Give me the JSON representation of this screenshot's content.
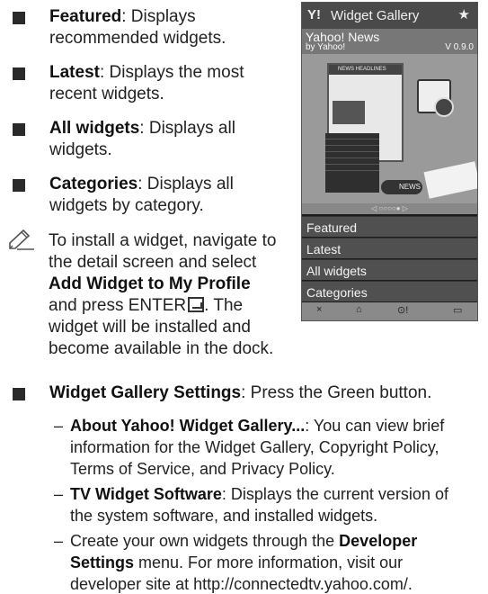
{
  "items": [
    {
      "label": "Featured",
      "desc_1": ": Displays",
      "desc_2": "recommended widgets."
    },
    {
      "label": "Latest",
      "desc_1": ": Displays the most",
      "desc_2": "recent widgets."
    },
    {
      "label": "All widgets",
      "desc_1": ": Displays all",
      "desc_2": "widgets."
    },
    {
      "label": "Categories",
      "desc_1": ": Displays all",
      "desc_2": "widgets by category."
    }
  ],
  "note": {
    "line1": "To install a widget, navigate to",
    "line2": "the detail screen and select",
    "line3_bold": "Add Widget to My Profile",
    "line4_pre": "and press ",
    "line4_enter": "ENTER",
    "line4_post": ". The",
    "line5": "widget will be installed and",
    "line6": "become available in the dock."
  },
  "widget_gallery_settings": {
    "label": "Widget Gallery Settings",
    "desc": ": Press the Green button.",
    "subs": [
      {
        "dash": "–",
        "label": "About Yahoo! Widget Gallery...",
        "text_1": ": You can view brief",
        "text_2": "information for the Widget Gallery, Copyright Policy,",
        "text_3": "Terms of Service, and Privacy Policy."
      },
      {
        "dash": "–",
        "label": "TV Widget Software",
        "text_1": ": Displays the current version of",
        "text_2": "the system software, and installed widgets."
      },
      {
        "dash": "–",
        "pre": "Create your own widgets through the ",
        "label_a": "Developer",
        "label_b": "Settings",
        "text_1": " menu. For more information, visit our",
        "text_2": "developer site at http://connectedtv.yahoo.com/."
      }
    ]
  },
  "tv_screen": {
    "header_logo": "Y!",
    "header_title": "Widget Gallery",
    "header_star": "★",
    "app_name": "Yahoo! News",
    "app_by": "by Yahoo!",
    "app_version": "V 0.9.0",
    "window_title": "NEWS HEADLINES",
    "menu_items": [
      "Top Stories",
      "Business",
      "Politics",
      "Sports",
      "Technology",
      "More Categories"
    ],
    "news_label": "NEWS",
    "dots": "◁ ○○○○● ▷",
    "nav_items": [
      "Featured",
      "Latest",
      "All widgets",
      "Categories"
    ],
    "footer_icons": [
      "×",
      "⌂",
      "⊙!",
      "▭"
    ]
  }
}
